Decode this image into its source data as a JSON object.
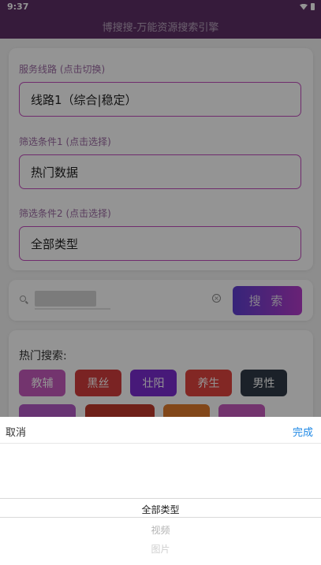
{
  "status": {
    "time": "9:37"
  },
  "header": {
    "title": "博搜搜-万能资源搜索引擎"
  },
  "filters": {
    "route_label": "服务线路 (点击切换)",
    "route_value": "线路1（综合|稳定）",
    "filter1_label": "筛选条件1 (点击选择)",
    "filter1_value": "热门数据",
    "filter2_label": "筛选条件2 (点击选择)",
    "filter2_value": "全部类型"
  },
  "search": {
    "button_label": "搜 索",
    "clear_glyph": "×"
  },
  "hot": {
    "title": "热门搜索:",
    "tags": [
      {
        "label": "教辅",
        "color": "#c65bbd"
      },
      {
        "label": "黑丝",
        "color": "#d23d3d"
      },
      {
        "label": "壮阳",
        "color": "#7a2bd0"
      },
      {
        "label": "养生",
        "color": "#e0443f"
      },
      {
        "label": "男性",
        "color": "#2f3a47"
      }
    ]
  },
  "picker": {
    "cancel_label": "取消",
    "done_label": "完成",
    "options": [
      "全部类型",
      "视频",
      "图片"
    ],
    "selected_index": 0
  }
}
